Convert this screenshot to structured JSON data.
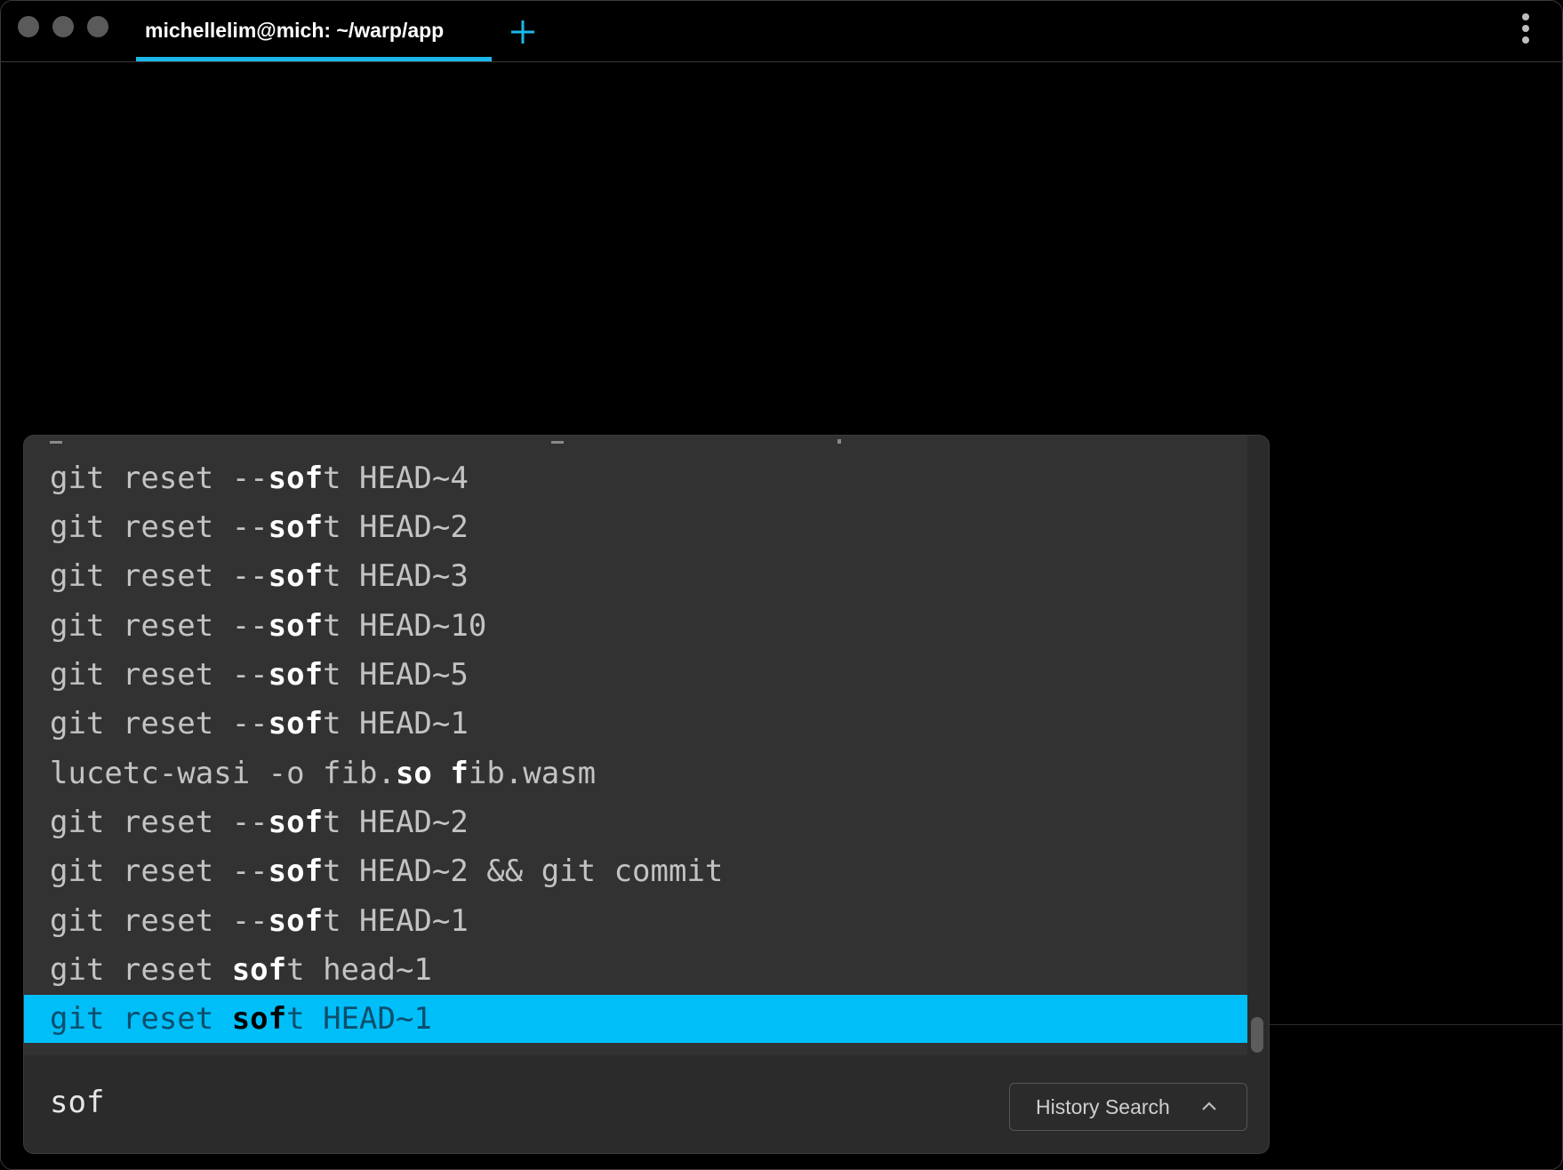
{
  "window": {
    "tab_title": "michellelim@mich: ~/warp/app",
    "colors": {
      "accent": "#1ab8ea",
      "selection": "#00bff8",
      "panel": "#2b2b2b",
      "list": "#323232"
    },
    "icons": [
      "new-tab-plus-icon",
      "more-vertical-icon"
    ]
  },
  "history": {
    "rows": [
      {
        "pre": "git reset --",
        "match": "sof",
        "post": "t HEAD~4",
        "selected": false
      },
      {
        "pre": "git reset --",
        "match": "sof",
        "post": "t HEAD~2",
        "selected": false
      },
      {
        "pre": "git reset --",
        "match": "sof",
        "post": "t HEAD~3",
        "selected": false
      },
      {
        "pre": "git reset --",
        "match": "sof",
        "post": "t HEAD~10",
        "selected": false
      },
      {
        "pre": "git reset --",
        "match": "sof",
        "post": "t HEAD~5",
        "selected": false
      },
      {
        "pre": "git reset --",
        "match": "sof",
        "post": "t HEAD~1",
        "selected": false
      },
      {
        "pre": "lucetc-wasi -o fib.",
        "match": "so",
        "mid": " ",
        "match2": "f",
        "post": "ib.wasm",
        "selected": false
      },
      {
        "pre": "git reset --",
        "match": "sof",
        "post": "t HEAD~2",
        "selected": false
      },
      {
        "pre": "git reset --",
        "match": "sof",
        "post": "t HEAD~2 && git commit",
        "selected": false
      },
      {
        "pre": "git reset --",
        "match": "sof",
        "post": "t HEAD~1",
        "selected": false
      },
      {
        "pre": "git reset ",
        "match": "sof",
        "post": "t head~1",
        "selected": false
      },
      {
        "pre": "git reset ",
        "match": "sof",
        "post": "t HEAD~1",
        "selected": true
      }
    ]
  },
  "search": {
    "query": "sof",
    "mode_label": "History Search",
    "mode_icon": "chevron-up-icon"
  }
}
